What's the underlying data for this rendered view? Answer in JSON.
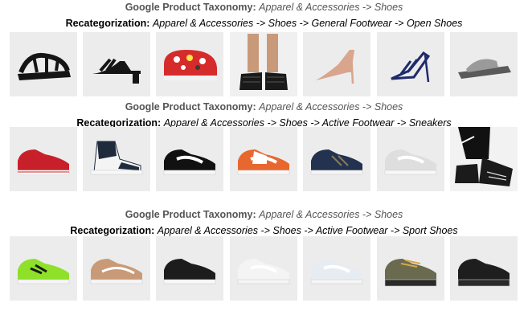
{
  "sections": [
    {
      "taxonomy_label": "Google Product Taxonomy:",
      "taxonomy_value": "Apparel & Accessories -> Shoes",
      "recat_label": "Recategorization:",
      "recat_value": "Apparel & Accessories -> Shoes -> General Footwear -> Open Shoes",
      "products": [
        {
          "name": "black-sport-sandal-icon",
          "bg": "#ececec",
          "color": "#151515"
        },
        {
          "name": "black-heeled-strap-sandal-icon",
          "bg": "#ececec",
          "color": "#151515"
        },
        {
          "name": "red-graphic-clog-icon",
          "bg": "#ececec",
          "color": "#d62b2b"
        },
        {
          "name": "black-fisherman-sandal-worn-icon",
          "bg": "#f0f0f0",
          "color": "#1a1a1a"
        },
        {
          "name": "nude-pointed-pump-icon",
          "bg": "#ececec",
          "color": "#d9a58c"
        },
        {
          "name": "navy-mule-sandal-icon",
          "bg": "#ececec",
          "color": "#1f2a6a"
        },
        {
          "name": "grey-slide-sandal-icon",
          "bg": "#ececec",
          "color": "#9a9a9a"
        }
      ]
    },
    {
      "taxonomy_label": "Google Product Taxonomy:",
      "taxonomy_value": "Apparel & Accessories -> Shoes",
      "recat_label": "Recategorization:",
      "recat_value": "Apparel & Accessories -> Shoes -> Active Footwear -> Sneakers",
      "products": [
        {
          "name": "red-canvas-sneaker-icon",
          "bg": "#ececec",
          "color": "#c8202a"
        },
        {
          "name": "navy-white-high-top-sneaker-icon",
          "bg": "#ececec",
          "color": "#1f2b3d"
        },
        {
          "name": "black-white-low-sneaker-icon",
          "bg": "#ececec",
          "color": "#111111"
        },
        {
          "name": "orange-white-low-sneaker-icon",
          "bg": "#ececec",
          "color": "#e8672e"
        },
        {
          "name": "navy-suede-running-sneaker-icon",
          "bg": "#ececec",
          "color": "#23324f"
        },
        {
          "name": "white-knit-sneaker-icon",
          "bg": "#ececec",
          "color": "#dedede"
        },
        {
          "name": "black-chunky-sneaker-worn-icon",
          "bg": "#f2f2f2",
          "color": "#1b1b1b"
        }
      ]
    },
    {
      "taxonomy_label": "Google Product Taxonomy:",
      "taxonomy_value": "Apparel & Accessories -> Shoes",
      "recat_label": "Recategorization:",
      "recat_value": "Apparel & Accessories -> Shoes -> Active Footwear -> Sport Shoes",
      "products": [
        {
          "name": "green-indoor-football-shoe-icon",
          "bg": "#ececec",
          "color": "#8ee029"
        },
        {
          "name": "tan-indoor-football-shoe-icon",
          "bg": "#ececec",
          "color": "#c99a78"
        },
        {
          "name": "black-training-shoe-icon",
          "bg": "#ececec",
          "color": "#1c1c1c"
        },
        {
          "name": "white-running-shoe-icon",
          "bg": "#ececec",
          "color": "#f4f4f4"
        },
        {
          "name": "white-blue-running-shoe-icon",
          "bg": "#ececec",
          "color": "#e7ecf2"
        },
        {
          "name": "olive-hiking-shoe-icon",
          "bg": "#ececec",
          "color": "#6a6b4e"
        },
        {
          "name": "black-basketball-shoe-icon",
          "bg": "#ececec",
          "color": "#1e1e1e"
        }
      ]
    }
  ]
}
